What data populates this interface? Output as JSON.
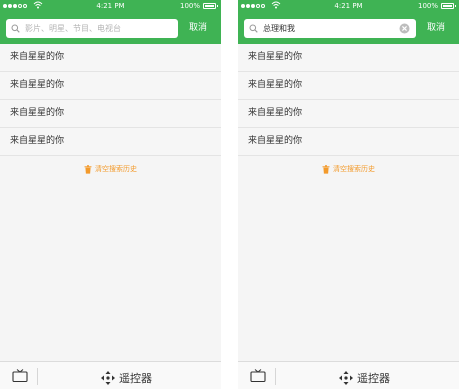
{
  "colors": {
    "brand_green": "#3fb354",
    "accent_orange": "#f39a2b",
    "background": "#f5f5f5",
    "divider": "#e4e4e4"
  },
  "screens": [
    {
      "status": {
        "time": "4:21 PM",
        "battery": "100%"
      },
      "search": {
        "placeholder": "影片、明星、节目、电视台",
        "value": "",
        "icon": "search-icon"
      },
      "cancel_label": "取消",
      "history": [
        {
          "label": "来自星星的你"
        },
        {
          "label": "来自星星的你"
        },
        {
          "label": "来自星星的你"
        },
        {
          "label": "来自星星的你"
        }
      ],
      "clear_history": {
        "label": "清空搜索历史",
        "icon": "trash-icon"
      },
      "bottom_bar": {
        "tv_icon": "tv-icon",
        "remote_label": "遥控器",
        "remote_icon": "remote-dpad-icon"
      }
    },
    {
      "status": {
        "time": "4:21 PM",
        "battery": "100%"
      },
      "search": {
        "placeholder": "",
        "value": "总理和我",
        "icon": "search-icon",
        "clear_icon": "clear-icon"
      },
      "cancel_label": "取消",
      "history": [
        {
          "label": "来自星星的你"
        },
        {
          "label": "来自星星的你"
        },
        {
          "label": "来自星星的你"
        },
        {
          "label": "来自星星的你"
        }
      ],
      "clear_history": {
        "label": "清空搜索历史",
        "icon": "trash-icon"
      },
      "bottom_bar": {
        "tv_icon": "tv-icon",
        "remote_label": "遥控器",
        "remote_icon": "remote-dpad-icon"
      }
    }
  ]
}
